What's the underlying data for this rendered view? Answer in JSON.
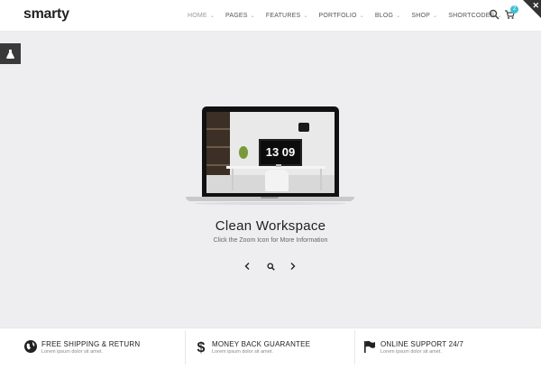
{
  "header": {
    "logo": "smarty",
    "nav": [
      {
        "label": "HOME",
        "active": true,
        "has_dropdown": true
      },
      {
        "label": "PAGES",
        "active": false,
        "has_dropdown": true
      },
      {
        "label": "FEATURES",
        "active": false,
        "has_dropdown": true
      },
      {
        "label": "PORTFOLIO",
        "active": false,
        "has_dropdown": true
      },
      {
        "label": "BLOG",
        "active": false,
        "has_dropdown": true
      },
      {
        "label": "SHOP",
        "active": false,
        "has_dropdown": true
      },
      {
        "label": "SHORTCODES",
        "active": false,
        "has_dropdown": true
      }
    ],
    "cart_count": "2",
    "icons": {
      "search": "search-icon",
      "cart": "cart-icon",
      "corner": "close-icon"
    }
  },
  "hero": {
    "side_tab_icon": "flask-icon",
    "clock": "13 09",
    "title": "Clean Workspace",
    "subtitle": "Click the Zoom Icon for More Information",
    "controls": {
      "prev": "chevron-left-icon",
      "zoom": "search-icon",
      "next": "chevron-right-icon"
    }
  },
  "features": [
    {
      "icon": "globe-icon",
      "title": "FREE SHIPPING & RETURN",
      "desc": "Lorem ipsum dolor sit amet."
    },
    {
      "icon": "dollar-icon",
      "title": "MONEY BACK GUARANTEE",
      "desc": "Lorem ipsum dolor sit amet."
    },
    {
      "icon": "flag-icon",
      "title": "ONLINE SUPPORT 24/7",
      "desc": "Lorem ipsum dolor sit amet."
    }
  ],
  "colors": {
    "accent": "#3bc1d6",
    "hero_bg": "#eeeef0",
    "dark": "#333333"
  }
}
